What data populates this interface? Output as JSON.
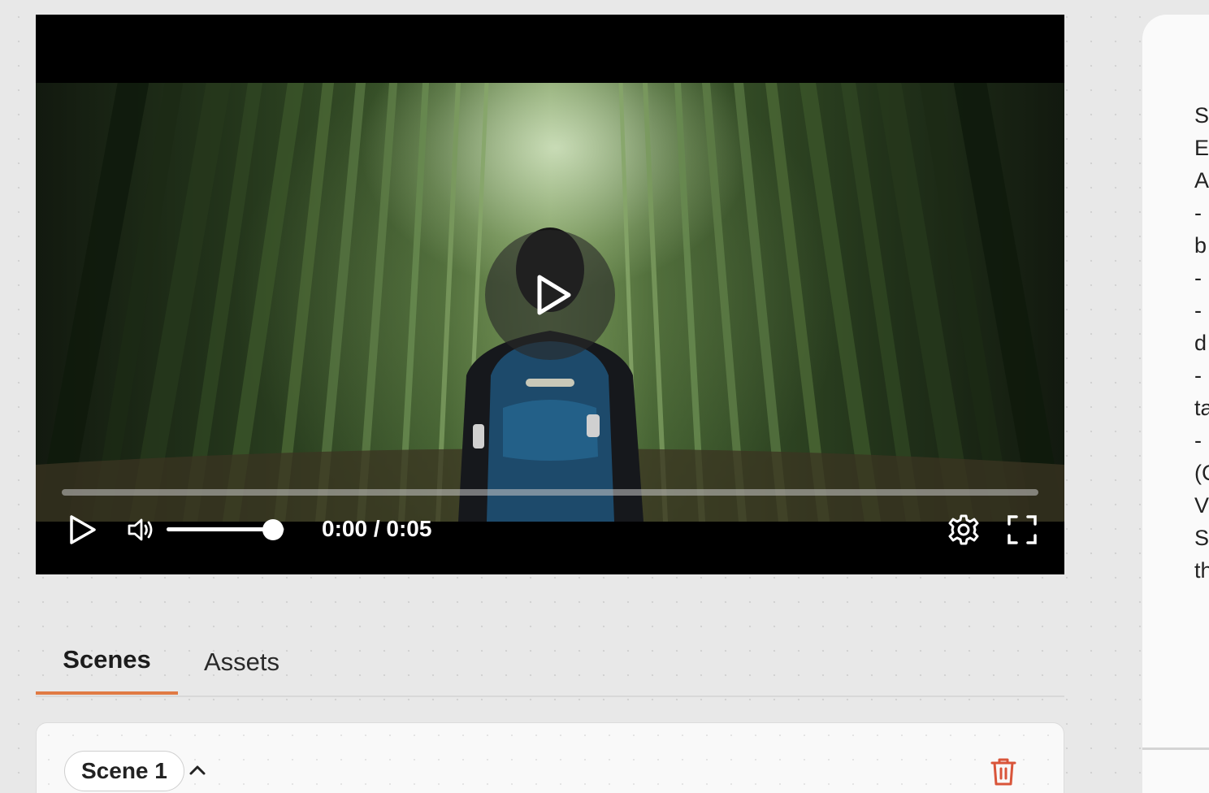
{
  "player": {
    "time_display": "0:00 / 0:05",
    "progress_fraction": 0.0,
    "volume_fraction": 0.9,
    "icons": {
      "big_play": "play-icon",
      "play": "play-icon",
      "volume": "volume-icon",
      "settings": "gear-icon",
      "fullscreen": "fullscreen-icon"
    }
  },
  "tabs": [
    {
      "label": "Scenes",
      "active": true
    },
    {
      "label": "Assets",
      "active": false
    }
  ],
  "scene_card": {
    "scene_label": "Scene 1",
    "collapse_icon": "chevron-up-icon",
    "delete_icon": "trash-icon"
  },
  "right_panel": {
    "visible_text_lines": [
      "S",
      "E",
      "A",
      "-",
      "b",
      "-",
      "-",
      "d",
      "-",
      "ta",
      "-",
      "(C",
      "V",
      "S",
      "th"
    ]
  },
  "colors": {
    "accent": "#e07a44",
    "delete": "#d9553a"
  }
}
